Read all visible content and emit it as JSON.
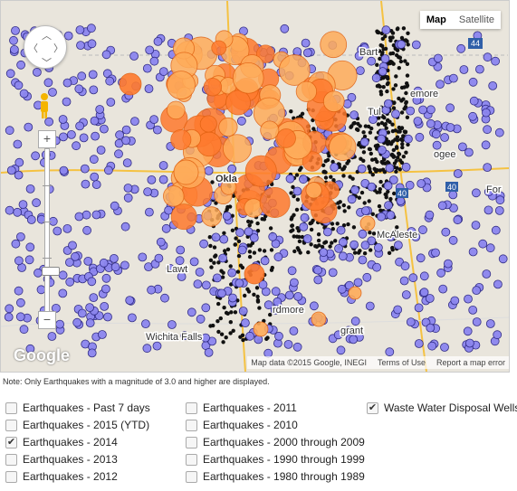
{
  "map": {
    "type_buttons": [
      {
        "label": "Map",
        "active": true
      },
      {
        "label": "Satellite",
        "active": false
      }
    ],
    "attribution": {
      "data": "Map data ©2015 Google, INEGI",
      "terms": "Terms of Use",
      "report": "Report a map error"
    },
    "logo": "Google",
    "city_labels": [
      "Bart",
      "Tul",
      "emore",
      "ogee",
      "Okla",
      "For",
      "McAleste",
      "Lawt",
      "Wichita Falls",
      "rdmore",
      "grant"
    ],
    "highway_labels": [
      "44",
      "40",
      "40"
    ],
    "colors": {
      "land": "#e9e5dc",
      "road": "#f5c242",
      "quake_small": "#8c86ef",
      "quake_small_outline": "#2a2580",
      "well": "#111111",
      "quake_large": "#ff7a2e",
      "quake_large_alt": "#ffac5a"
    }
  },
  "note": "Note: Only Earthquakes with a magnitude of 3.0 and higher are displayed.",
  "filters": [
    {
      "label": "Earthquakes - Past 7 days",
      "checked": false
    },
    {
      "label": "Earthquakes - 2015 (YTD)",
      "checked": false
    },
    {
      "label": "Earthquakes - 2014",
      "checked": true
    },
    {
      "label": "Earthquakes - 2013",
      "checked": false
    },
    {
      "label": "Earthquakes - 2012",
      "checked": false
    },
    {
      "label": "Earthquakes - 2011",
      "checked": false
    },
    {
      "label": "Earthquakes - 2010",
      "checked": false
    },
    {
      "label": "Earthquakes - 2000 through 2009",
      "checked": false
    },
    {
      "label": "Earthquakes - 1990 through 1999",
      "checked": false
    },
    {
      "label": "Earthquakes - 1980 through 1989",
      "checked": false
    },
    {
      "label": "Waste Water Disposal Wells",
      "checked": true
    }
  ]
}
